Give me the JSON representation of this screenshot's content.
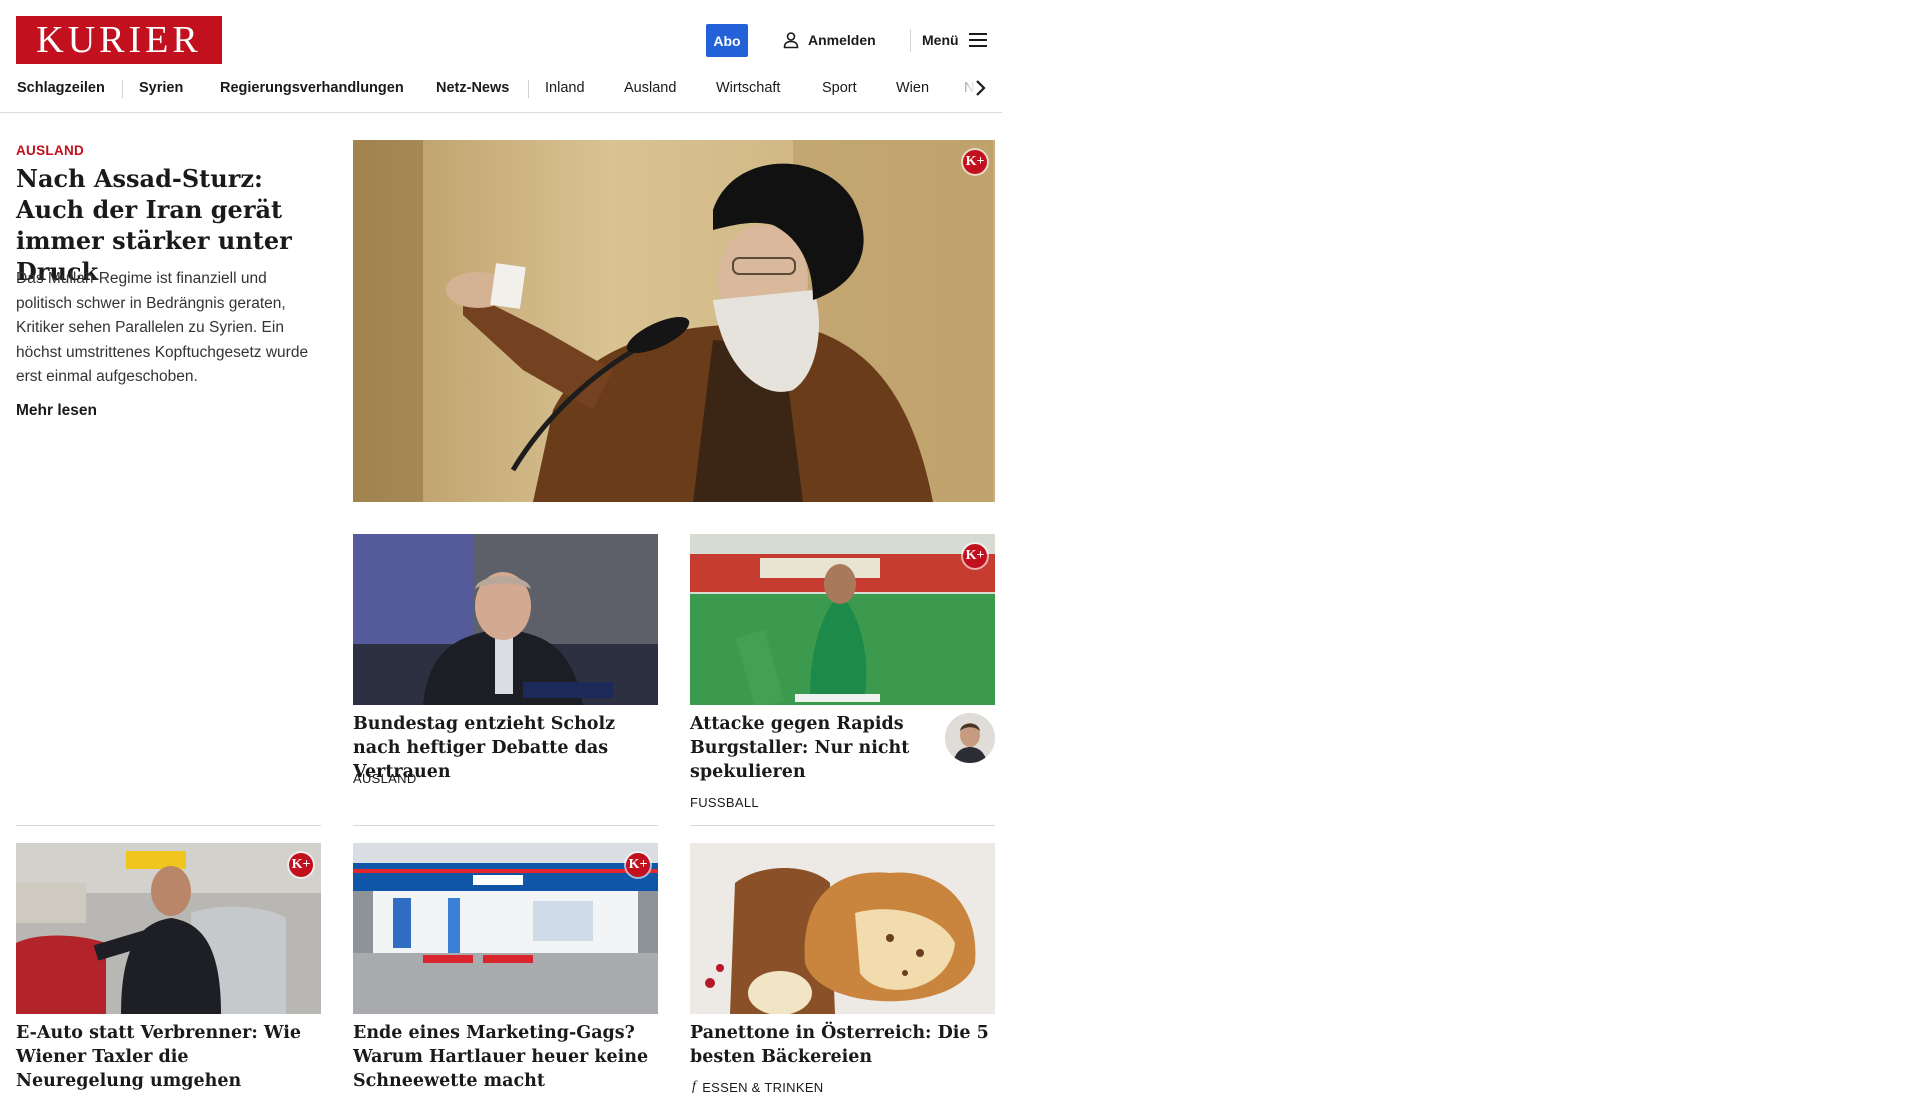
{
  "header": {
    "logo_text": "KURIER",
    "abo_label": "Abo",
    "login_label": "Anmelden",
    "menu_label": "Menü"
  },
  "nav": {
    "items": [
      "Schlagzeilen",
      "Syrien",
      "Regierungsverhandlungen",
      "Netz-News",
      "Inland",
      "Ausland",
      "Wirtschaft",
      "Sport",
      "Wien",
      "NÖ"
    ]
  },
  "lead": {
    "category": "AUSLAND",
    "title": "Nach Assad-Sturz: Auch der Iran gerät immer stär­ker unter Druck",
    "teaser": "Das Mullah-Regime ist finanziell und politisch schwer in Bedrängnis geraten, Kritiker sehen Parallelen zu Syrien. Ein höchst umstrittenes Kopftuchgesetz wurde erst einmal aufgeschoben.",
    "more_label": "Mehr lesen",
    "premium_badge": "K+"
  },
  "cards": [
    {
      "title": "Bundestag entzieht Scholz nach heftiger Debatte das Vertrauen",
      "category": "AUSLAND",
      "premium": false
    },
    {
      "title": "Attacke gegen Rapids Burgstaller: Nur nicht spekulieren",
      "category": "FUSSBALL",
      "premium": true,
      "premium_badge": "K+"
    },
    {
      "title": "E-Auto statt Verbrenner: Wie Wie­ner Taxler die Neuregelung umgehen",
      "category": "",
      "premium": true,
      "premium_badge": "K+"
    },
    {
      "title": "Ende eines Marketing-Gags? Warum Hartlauer heuer keine Schneewette macht",
      "category": "",
      "premium": true,
      "premium_badge": "K+"
    },
    {
      "title": "Panettone in Österreich: Die 5 bes­ten Bäckereien",
      "category": "ESSEN & TRINKEN",
      "premium": false,
      "category_icon": "f"
    }
  ],
  "colors": {
    "brand": "#c2101e",
    "abo": "#2361d8"
  },
  "icons": [
    "user-icon",
    "hamburger-menu-icon",
    "chevron-right-icon",
    "essen-trinken-icon"
  ]
}
